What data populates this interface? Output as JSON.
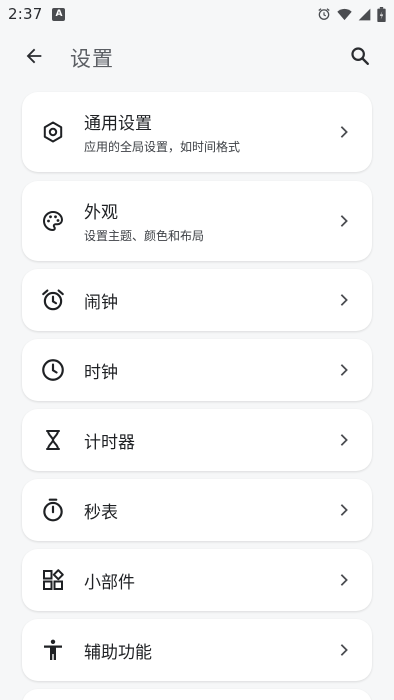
{
  "status_bar": {
    "time": "2:37",
    "notification_badge": "A",
    "icons": [
      "alarm-icon",
      "wifi-icon",
      "signal-icon",
      "battery-icon"
    ]
  },
  "app_bar": {
    "title": "设置",
    "back_icon": "arrow-back-icon",
    "search_icon": "search-icon"
  },
  "settings": [
    {
      "id": "general",
      "label": "通用设置",
      "subtitle": "应用的全局设置，如时间格式",
      "icon": "hexagon-settings-icon"
    },
    {
      "id": "appearance",
      "label": "外观",
      "subtitle": "设置主题、颜色和布局",
      "icon": "palette-icon"
    },
    {
      "id": "alarm",
      "label": "闹钟",
      "icon": "alarm-clock-icon"
    },
    {
      "id": "clock",
      "label": "时钟",
      "icon": "clock-icon"
    },
    {
      "id": "timer",
      "label": "计时器",
      "icon": "hourglass-icon"
    },
    {
      "id": "stopwatch",
      "label": "秒表",
      "icon": "stopwatch-icon"
    },
    {
      "id": "widgets",
      "label": "小部件",
      "icon": "widgets-icon"
    },
    {
      "id": "accessibility",
      "label": "辅助功能",
      "icon": "accessibility-icon"
    }
  ],
  "colors": {
    "background": "#f6f7f8",
    "card": "#ffffff",
    "text_primary": "#1f2124",
    "title_text": "#5b5e63"
  }
}
